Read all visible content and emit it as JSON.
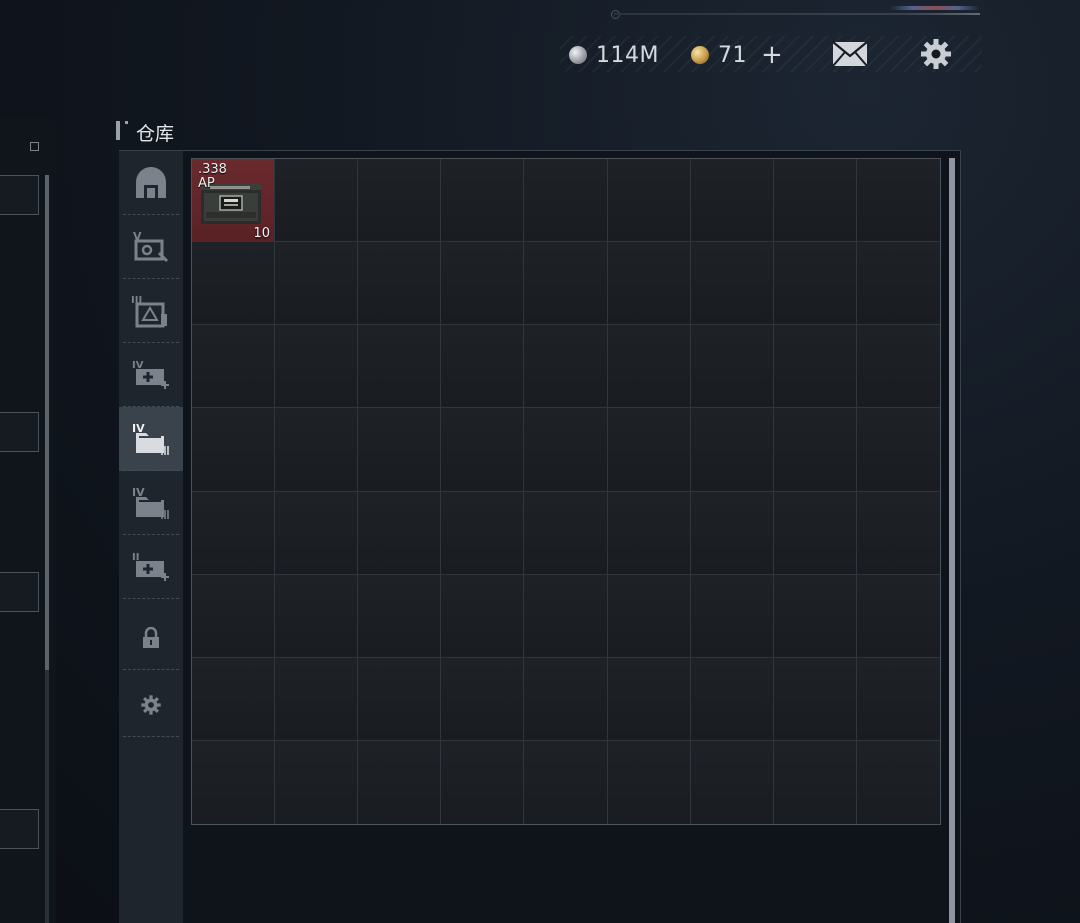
{
  "currencies": {
    "silver": {
      "value": "114M",
      "icon": "silver-coin-icon"
    },
    "gold": {
      "value": "71",
      "add_label": "+",
      "icon": "gold-coin-icon"
    }
  },
  "header": {
    "mail_icon": "mail-icon",
    "settings_icon": "gear-icon"
  },
  "warehouse": {
    "title": "仓库",
    "tabs": [
      {
        "icon": "home-storage-icon",
        "roman": ""
      },
      {
        "icon": "container-v-icon",
        "roman": "V"
      },
      {
        "icon": "container-iii-icon",
        "roman": "III"
      },
      {
        "icon": "medical-iv-icon",
        "roman": "IV"
      },
      {
        "icon": "folder-iv-icon",
        "roman": "IV",
        "active": true
      },
      {
        "icon": "folder-iv-icon",
        "roman": "IV"
      },
      {
        "icon": "medical-ii-icon",
        "roman": "II"
      },
      {
        "icon": "lock-icon",
        "roman": ""
      },
      {
        "icon": "gear-icon",
        "roman": ""
      }
    ],
    "grid": {
      "columns": 9,
      "rows": 8
    },
    "items": [
      {
        "name_line1": ".338",
        "name_line2": "AP",
        "count": "10",
        "icon": "ammo-box-icon",
        "color": "#6a2a2e"
      }
    ]
  }
}
